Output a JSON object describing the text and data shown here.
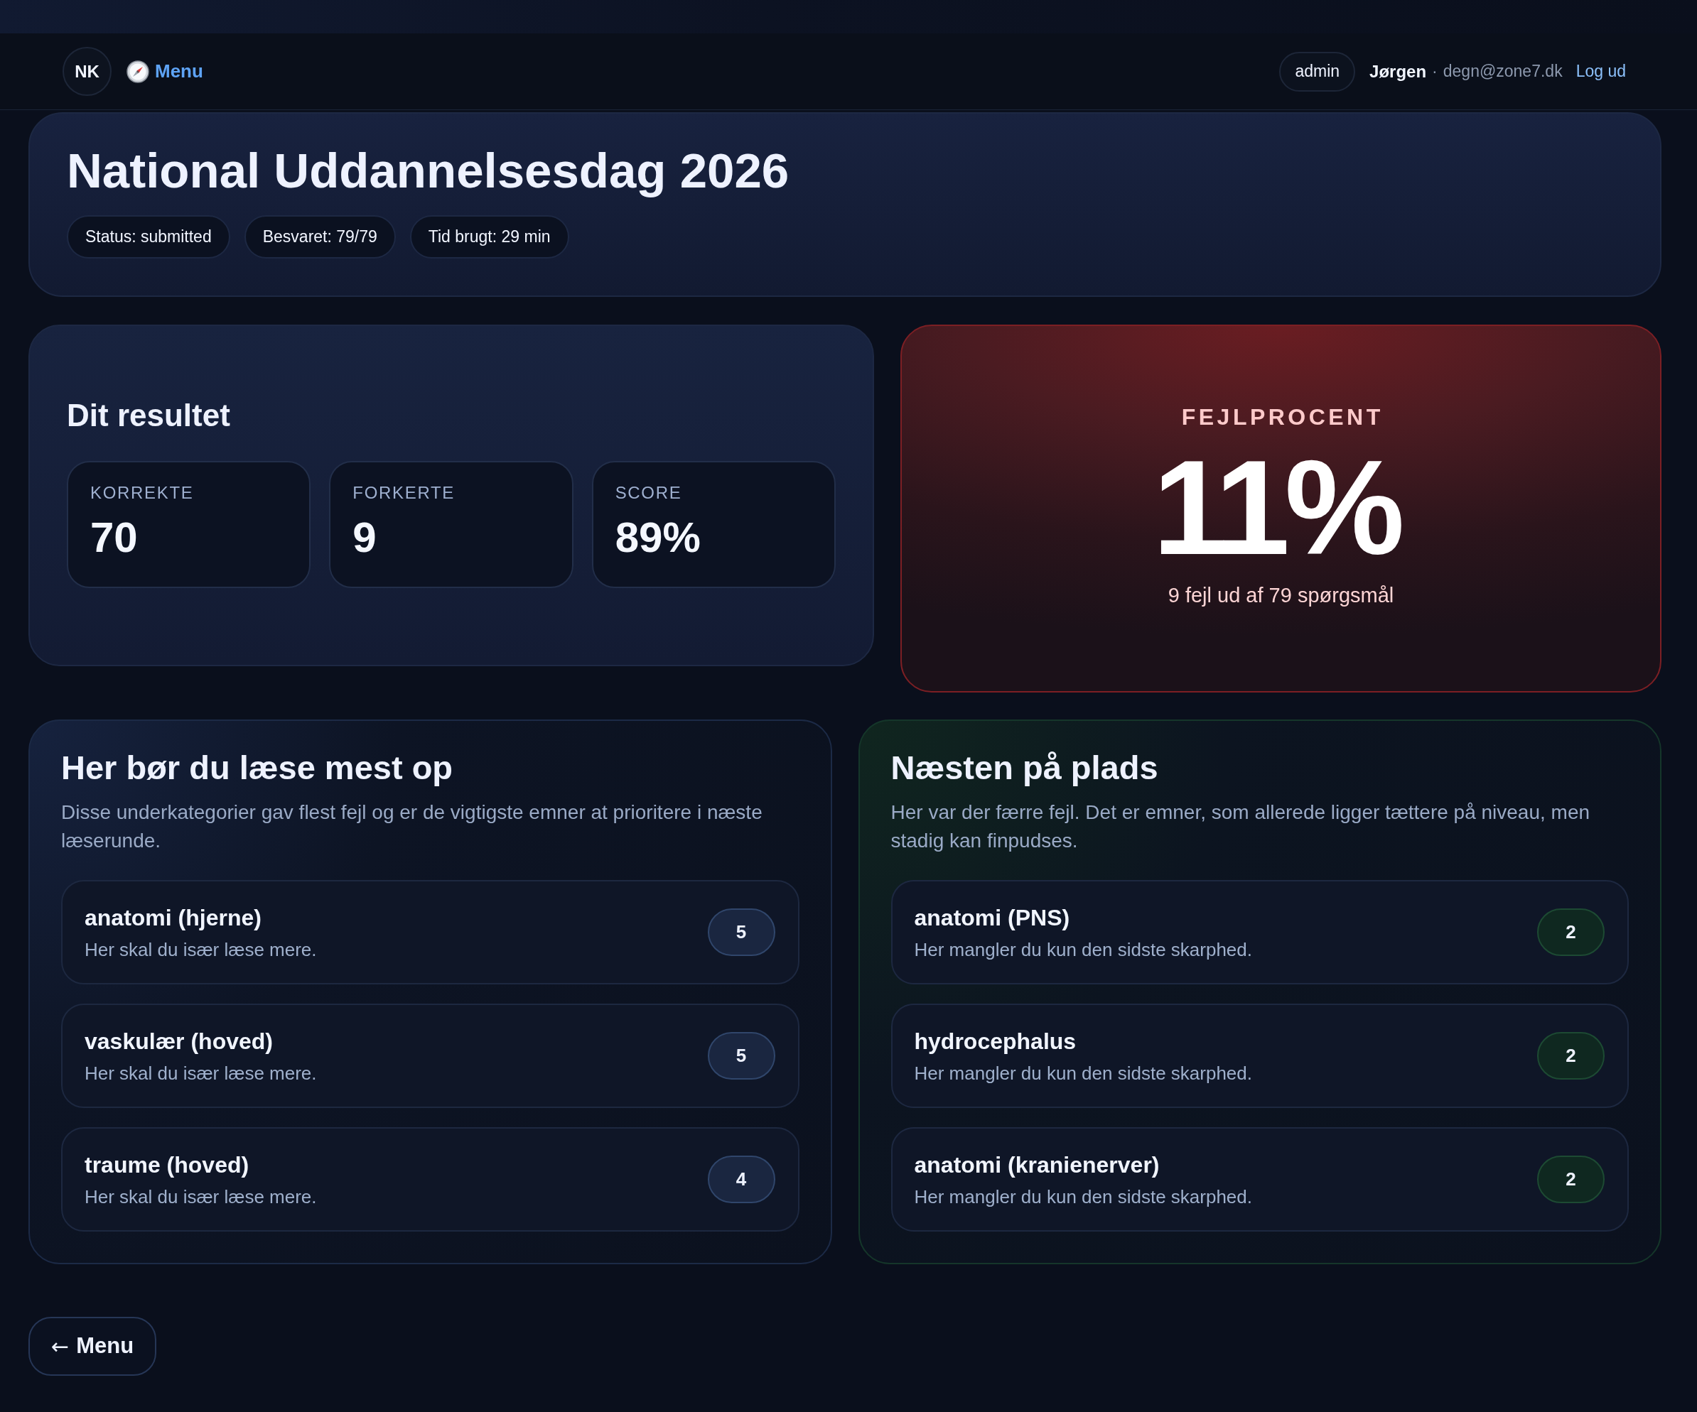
{
  "header": {
    "logo": "NK",
    "menu_link": "Menu",
    "role": "admin",
    "user_name": "Jørgen",
    "separator": "·",
    "user_email": "degn@zone7.dk",
    "logout_link": "Log ud"
  },
  "exam": {
    "title": "National Uddannelsesdag 2026",
    "chips": [
      "Status: submitted",
      "Besvaret: 79/79",
      "Tid brugt: 29 min"
    ]
  },
  "result": {
    "title": "Dit resultet",
    "stats": [
      {
        "label": "KORREKTE",
        "value": "70"
      },
      {
        "label": "FORKERTE",
        "value": "9"
      },
      {
        "label": "SCORE",
        "value": "89%"
      }
    ]
  },
  "error_rate": {
    "label": "FEJLPROCENT",
    "value": "11%",
    "caption": "9 fejl ud af 79 spørgsmål"
  },
  "study_most": {
    "title": "Her bør du læse mest op",
    "description": "Disse underkategorier gav flest fejl og er de vigtigste emner at prioritere i næste læserunde.",
    "items": [
      {
        "name": "anatomi (hjerne)",
        "note": "Her skal du især læse mere.",
        "count": "5"
      },
      {
        "name": "vaskulær (hoved)",
        "note": "Her skal du især læse mere.",
        "count": "5"
      },
      {
        "name": "traume (hoved)",
        "note": "Her skal du især læse mere.",
        "count": "4"
      }
    ]
  },
  "almost_there": {
    "title": "Næsten på plads",
    "description": "Her var der færre fejl. Det er emner, som allerede ligger tættere på niveau, men stadig kan finpudses.",
    "items": [
      {
        "name": "anatomi (PNS)",
        "note": "Her mangler du kun den sidste skarphed.",
        "count": "2"
      },
      {
        "name": "hydrocephalus",
        "note": "Her mangler du kun den sidste skarphed.",
        "count": "2"
      },
      {
        "name": "anatomi (kranienerver)",
        "note": "Her mangler du kun den sidste skarphed.",
        "count": "2"
      }
    ]
  },
  "back_button": {
    "arrow": "←",
    "label": "Menu"
  }
}
